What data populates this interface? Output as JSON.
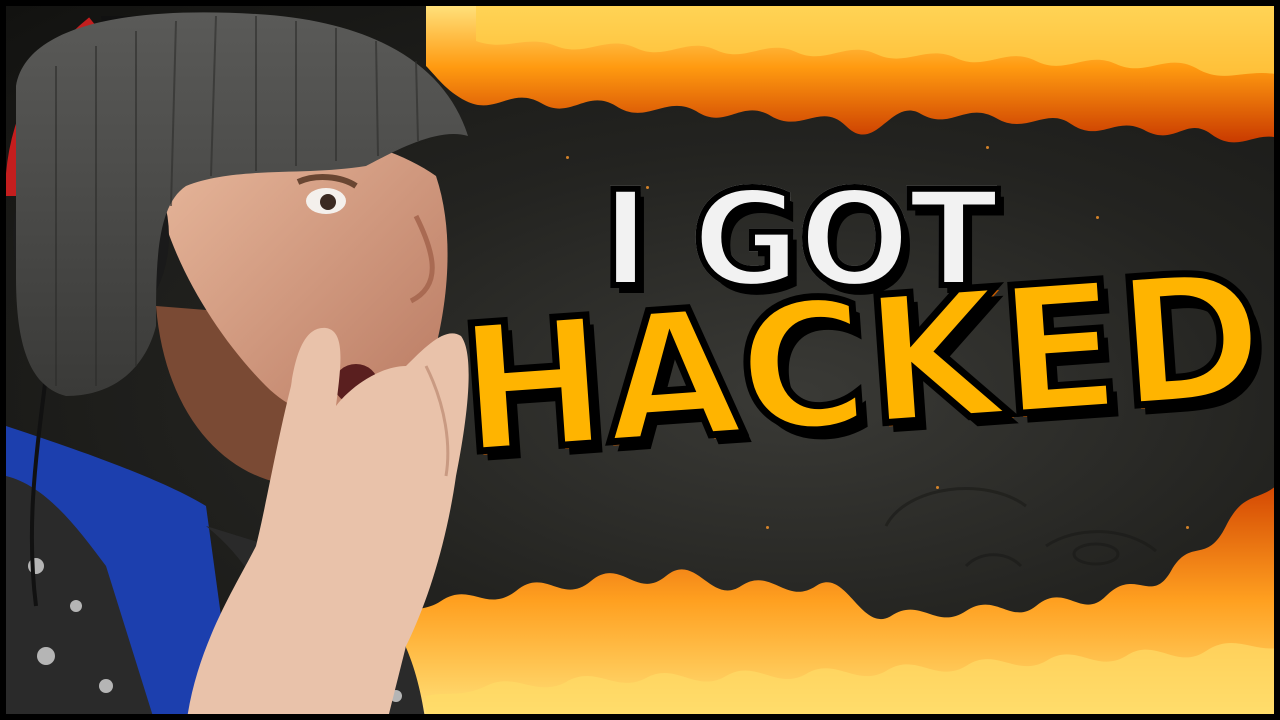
{
  "thumbnail": {
    "headline_line_1": "I GOT",
    "headline_line_2": "HACKED",
    "headset_logo_icon": "hyperx-logo-icon"
  },
  "colors": {
    "headline_white": "#f2f2f2",
    "headline_yellow": "#ffb400",
    "outline": "#000000",
    "flame_orange": "#ff7a00",
    "flame_yellow": "#ffd23a",
    "background_dark": "#232320",
    "beanie_grey": "#4a4a48",
    "headset_red": "#c41e1e",
    "shirt_blue": "#1c3fae"
  }
}
